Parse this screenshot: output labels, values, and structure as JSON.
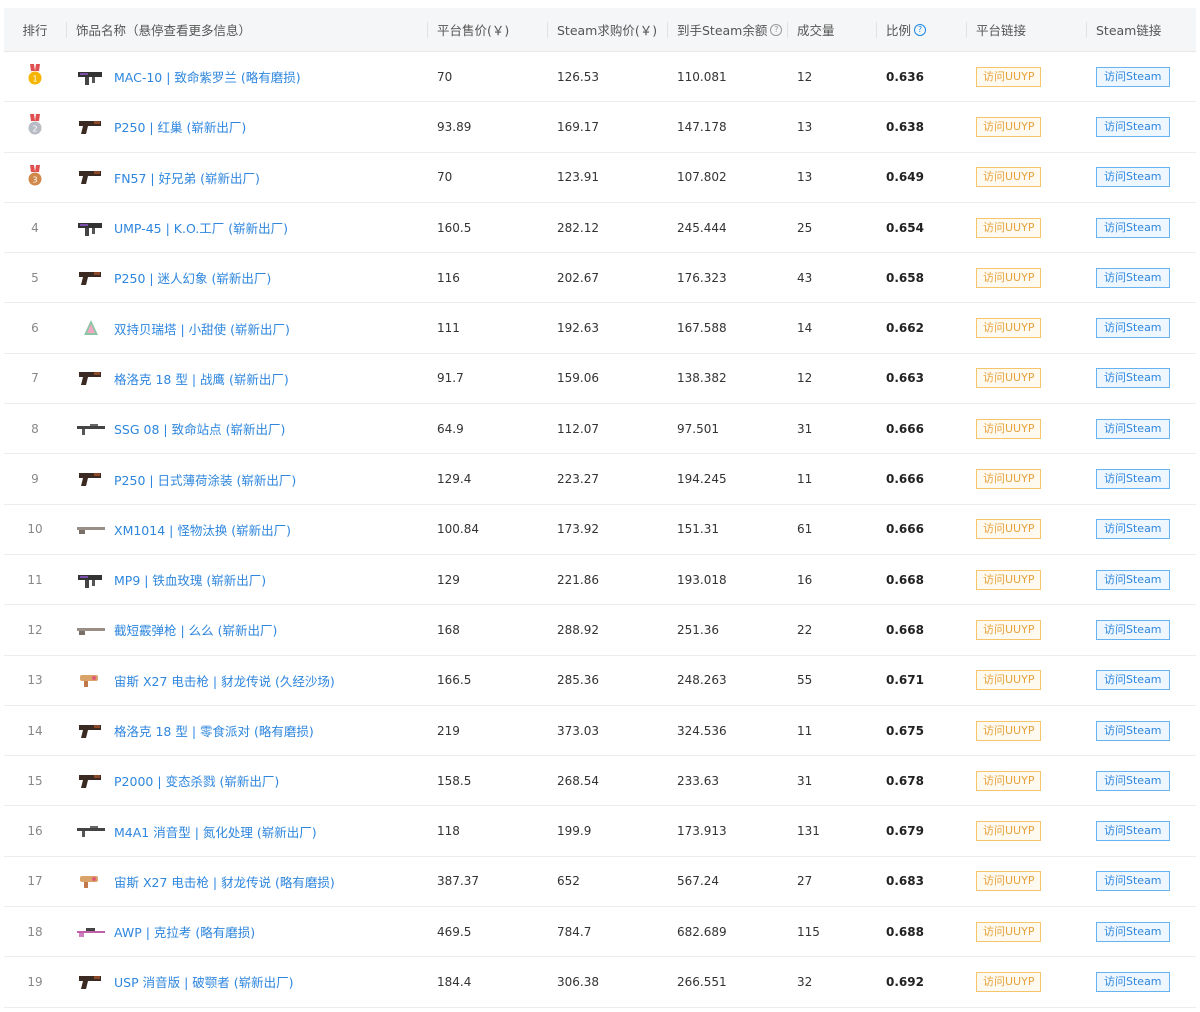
{
  "headers": {
    "rank": "排行",
    "name": "饰品名称（悬停查看更多信息）",
    "price": "平台售价(￥)",
    "steam_buy": "Steam求购价(￥)",
    "balance": "到手Steam余额",
    "volume": "成交量",
    "ratio": "比例",
    "platform_link": "平台链接",
    "steam_link": "Steam链接"
  },
  "button_labels": {
    "uuyp": "访问UUYP",
    "steam": "访问Steam"
  },
  "colors": {
    "link": "#2e86de",
    "uuyp_border": "#f5c56c",
    "steam_border": "#67b3f1",
    "gold": "#f4b400",
    "silver": "#b8bcc4",
    "bronze": "#d0884b"
  },
  "rows": [
    {
      "rank": "1",
      "medal": "gold",
      "name": "MAC-10 | 致命紫罗兰 (略有磨损)",
      "price": "70",
      "steam": "126.53",
      "balance": "110.081",
      "volume": "12",
      "ratio": "0.636",
      "gun_icon": "smg-icon"
    },
    {
      "rank": "2",
      "medal": "silver",
      "name": "P250 | 红巢 (崭新出厂)",
      "price": "93.89",
      "steam": "169.17",
      "balance": "147.178",
      "volume": "13",
      "ratio": "0.638",
      "gun_icon": "pistol-icon"
    },
    {
      "rank": "3",
      "medal": "bronze",
      "name": "FN57 | 好兄弟 (崭新出厂)",
      "price": "70",
      "steam": "123.91",
      "balance": "107.802",
      "volume": "13",
      "ratio": "0.649",
      "gun_icon": "pistol-icon"
    },
    {
      "rank": "4",
      "medal": "",
      "name": "UMP-45 | K.O.工厂 (崭新出厂)",
      "price": "160.5",
      "steam": "282.12",
      "balance": "245.444",
      "volume": "25",
      "ratio": "0.654",
      "gun_icon": "smg-icon"
    },
    {
      "rank": "5",
      "medal": "",
      "name": "P250 | 迷人幻象 (崭新出厂)",
      "price": "116",
      "steam": "202.67",
      "balance": "176.323",
      "volume": "43",
      "ratio": "0.658",
      "gun_icon": "pistol-icon"
    },
    {
      "rank": "6",
      "medal": "",
      "name": "双持贝瑞塔 | 小甜使 (崭新出厂)",
      "price": "111",
      "steam": "192.63",
      "balance": "167.588",
      "volume": "14",
      "ratio": "0.662",
      "gun_icon": "dual-pistol-icon"
    },
    {
      "rank": "7",
      "medal": "",
      "name": "格洛克 18 型 | 战鹰 (崭新出厂)",
      "price": "91.7",
      "steam": "159.06",
      "balance": "138.382",
      "volume": "12",
      "ratio": "0.663",
      "gun_icon": "pistol-icon"
    },
    {
      "rank": "8",
      "medal": "",
      "name": "SSG 08 | 致命站点 (崭新出厂)",
      "price": "64.9",
      "steam": "112.07",
      "balance": "97.501",
      "volume": "31",
      "ratio": "0.666",
      "gun_icon": "rifle-icon"
    },
    {
      "rank": "9",
      "medal": "",
      "name": "P250 | 日式薄荷涂装 (崭新出厂)",
      "price": "129.4",
      "steam": "223.27",
      "balance": "194.245",
      "volume": "11",
      "ratio": "0.666",
      "gun_icon": "pistol-icon"
    },
    {
      "rank": "10",
      "medal": "",
      "name": "XM1014 | 怪物汰换 (崭新出厂)",
      "price": "100.84",
      "steam": "173.92",
      "balance": "151.31",
      "volume": "61",
      "ratio": "0.666",
      "gun_icon": "shotgun-icon"
    },
    {
      "rank": "11",
      "medal": "",
      "name": "MP9 | 铁血玫瑰 (崭新出厂)",
      "price": "129",
      "steam": "221.86",
      "balance": "193.018",
      "volume": "16",
      "ratio": "0.668",
      "gun_icon": "smg-icon"
    },
    {
      "rank": "12",
      "medal": "",
      "name": "截短霰弹枪 | 么么 (崭新出厂)",
      "price": "168",
      "steam": "288.92",
      "balance": "251.36",
      "volume": "22",
      "ratio": "0.668",
      "gun_icon": "shotgun-icon"
    },
    {
      "rank": "13",
      "medal": "",
      "name": "宙斯 X27 电击枪 | 豺龙传说 (久经沙场)",
      "price": "166.5",
      "steam": "285.36",
      "balance": "248.263",
      "volume": "55",
      "ratio": "0.671",
      "gun_icon": "taser-icon"
    },
    {
      "rank": "14",
      "medal": "",
      "name": "格洛克 18 型 | 零食派对 (略有磨损)",
      "price": "219",
      "steam": "373.03",
      "balance": "324.536",
      "volume": "11",
      "ratio": "0.675",
      "gun_icon": "pistol-icon"
    },
    {
      "rank": "15",
      "medal": "",
      "name": "P2000 | 变态杀戮 (崭新出厂)",
      "price": "158.5",
      "steam": "268.54",
      "balance": "233.63",
      "volume": "31",
      "ratio": "0.678",
      "gun_icon": "pistol-icon"
    },
    {
      "rank": "16",
      "medal": "",
      "name": "M4A1 消音型 | 氮化处理 (崭新出厂)",
      "price": "118",
      "steam": "199.9",
      "balance": "173.913",
      "volume": "131",
      "ratio": "0.679",
      "gun_icon": "rifle-icon"
    },
    {
      "rank": "17",
      "medal": "",
      "name": "宙斯 X27 电击枪 | 豺龙传说 (略有磨损)",
      "price": "387.37",
      "steam": "652",
      "balance": "567.24",
      "volume": "27",
      "ratio": "0.683",
      "gun_icon": "taser-icon"
    },
    {
      "rank": "18",
      "medal": "",
      "name": "AWP | 克拉考 (略有磨损)",
      "price": "469.5",
      "steam": "784.7",
      "balance": "682.689",
      "volume": "115",
      "ratio": "0.688",
      "gun_icon": "sniper-icon"
    },
    {
      "rank": "19",
      "medal": "",
      "name": "USP 消音版 | 破颚者 (崭新出厂)",
      "price": "184.4",
      "steam": "306.38",
      "balance": "266.551",
      "volume": "32",
      "ratio": "0.692",
      "gun_icon": "pistol-icon"
    }
  ]
}
